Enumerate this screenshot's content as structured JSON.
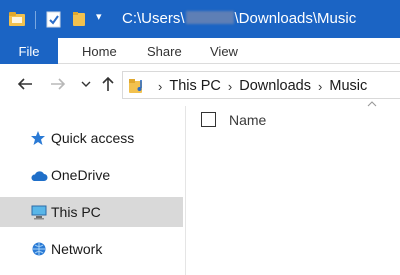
{
  "titlebar": {
    "path_prefix": "C:\\Users\\",
    "path_suffix": "\\Downloads\\Music",
    "dropdown_glyph": "▾"
  },
  "ribbon": {
    "tabs": [
      {
        "label": "File"
      },
      {
        "label": "Home"
      },
      {
        "label": "Share"
      },
      {
        "label": "View"
      }
    ]
  },
  "address": {
    "breadcrumbs": [
      "This PC",
      "Downloads",
      "Music"
    ],
    "separator": "›"
  },
  "sidebar": {
    "items": [
      {
        "label": "Quick access",
        "icon": "star-icon"
      },
      {
        "label": "OneDrive",
        "icon": "cloud-icon"
      },
      {
        "label": "This PC",
        "icon": "computer-icon",
        "selected": true
      },
      {
        "label": "Network",
        "icon": "network-icon"
      }
    ]
  },
  "content": {
    "column_name": "Name"
  },
  "colors": {
    "accent": "#1b64c4",
    "selected_bg": "#d9d9d9",
    "folder": "#e8b84a"
  }
}
